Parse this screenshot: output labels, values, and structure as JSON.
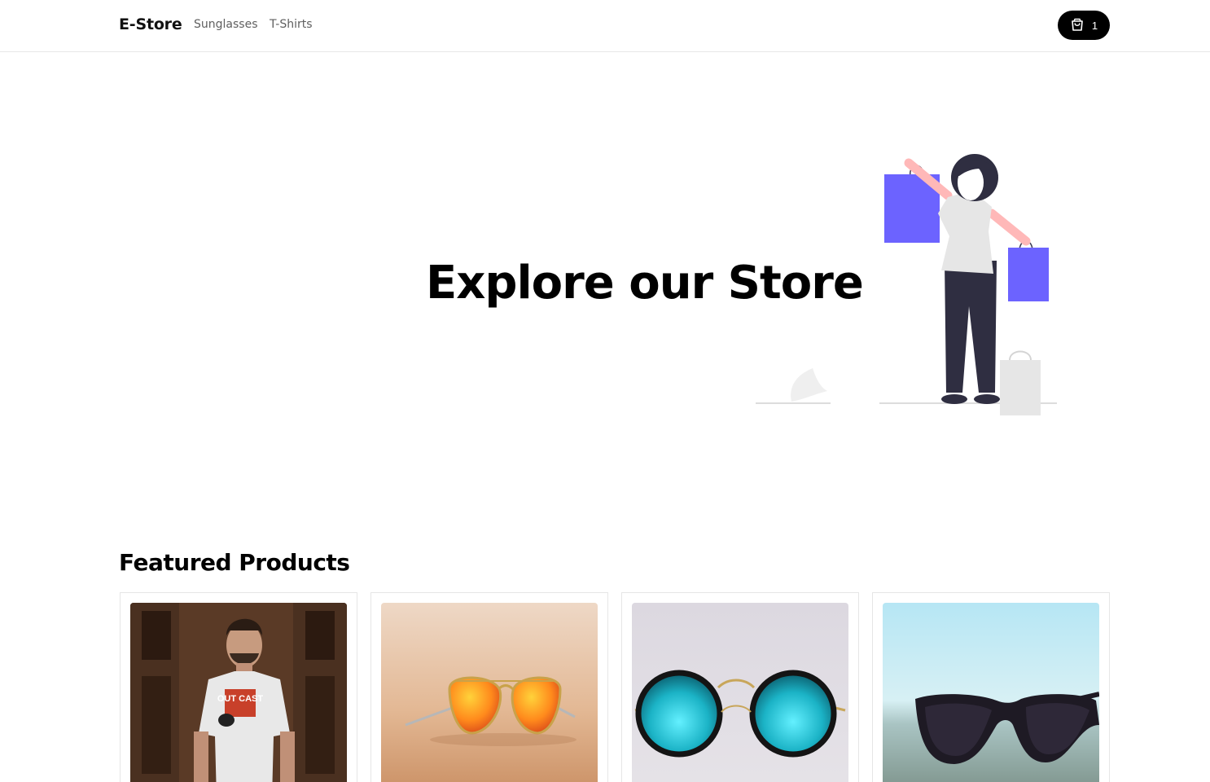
{
  "nav": {
    "brand": "E-Store",
    "links": [
      {
        "label": "Sunglasses"
      },
      {
        "label": "T-Shirts"
      }
    ],
    "cart": {
      "count": "1",
      "icon": "shopping-bag-icon"
    }
  },
  "hero": {
    "title": "Explore our Store",
    "illustration": "woman-shopping-illustration"
  },
  "featured": {
    "title": "Featured Products",
    "products": [
      {
        "image": "man-in-white-t-shirt-photo",
        "shirt_text": "OUT CAST"
      },
      {
        "image": "orange-aviator-sunglasses-photo"
      },
      {
        "image": "round-teal-sunglasses-photo"
      },
      {
        "image": "black-sport-sunglasses-photo"
      }
    ]
  },
  "colors": {
    "accent": "#6c63ff",
    "text": "#111111",
    "muted": "#5f5f5f",
    "border": "#e6e6e6"
  }
}
